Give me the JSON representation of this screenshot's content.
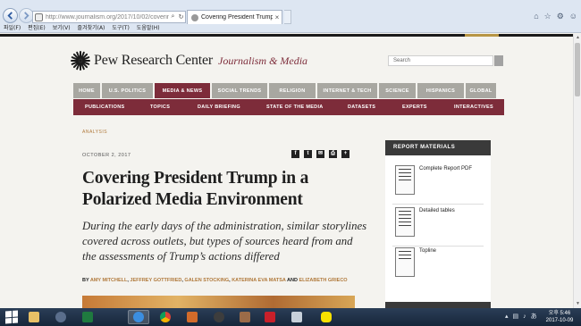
{
  "browser": {
    "address": "http://www.journalism.org/2017/10/02/covering-pre",
    "tab_title": "Covering President Trump ...",
    "tab_close": "×",
    "menu": [
      "파일(F)",
      "편집(E)",
      "보기(V)",
      "즐겨찾기(A)",
      "도구(T)",
      "도움말(H)"
    ]
  },
  "site": {
    "brand": "Pew Research Center",
    "section": "Journalism & Media",
    "search_placeholder": "Search",
    "main_nav": [
      {
        "label": "HOME",
        "active": false
      },
      {
        "label": "U.S. POLITICS",
        "active": false
      },
      {
        "label": "MEDIA & NEWS",
        "active": true
      },
      {
        "label": "SOCIAL TRENDS",
        "active": false
      },
      {
        "label": "RELIGION",
        "active": false
      },
      {
        "label": "INTERNET & TECH",
        "active": false
      },
      {
        "label": "SCIENCE",
        "active": false
      },
      {
        "label": "HISPANICS",
        "active": false
      },
      {
        "label": "GLOBAL",
        "active": false
      }
    ],
    "sub_nav": [
      "PUBLICATIONS",
      "TOPICS",
      "DAILY BRIEFING",
      "STATE OF THE MEDIA",
      "DATASETS",
      "EXPERTS",
      "INTERACTIVES"
    ]
  },
  "article": {
    "kicker": "ANALYSIS",
    "date": "OCTOBER 2, 2017",
    "headline": "Covering President Trump in a Polarized Media Environment",
    "dek": "During the early days of the administration, similar storylines covered across outlets, but types of sources heard from and the assessments of Trump’s actions differed",
    "by": "BY",
    "authors": [
      "AMY MITCHELL",
      "JEFFREY GOTTFRIED",
      "GALEN STOCKING",
      "KATERINA EVA MATSA",
      "ELIZABETH GRIECO"
    ],
    "and": "AND"
  },
  "sidebar": {
    "title": "REPORT MATERIALS",
    "items": [
      "Complete Report PDF",
      "Detailed tables",
      "Topline"
    ]
  },
  "taskbar": {
    "time": "오후 5:46",
    "date": "2017-10-09"
  },
  "colors": {
    "brand_maroon": "#7d2c3a",
    "author_gold": "#b0793b"
  }
}
